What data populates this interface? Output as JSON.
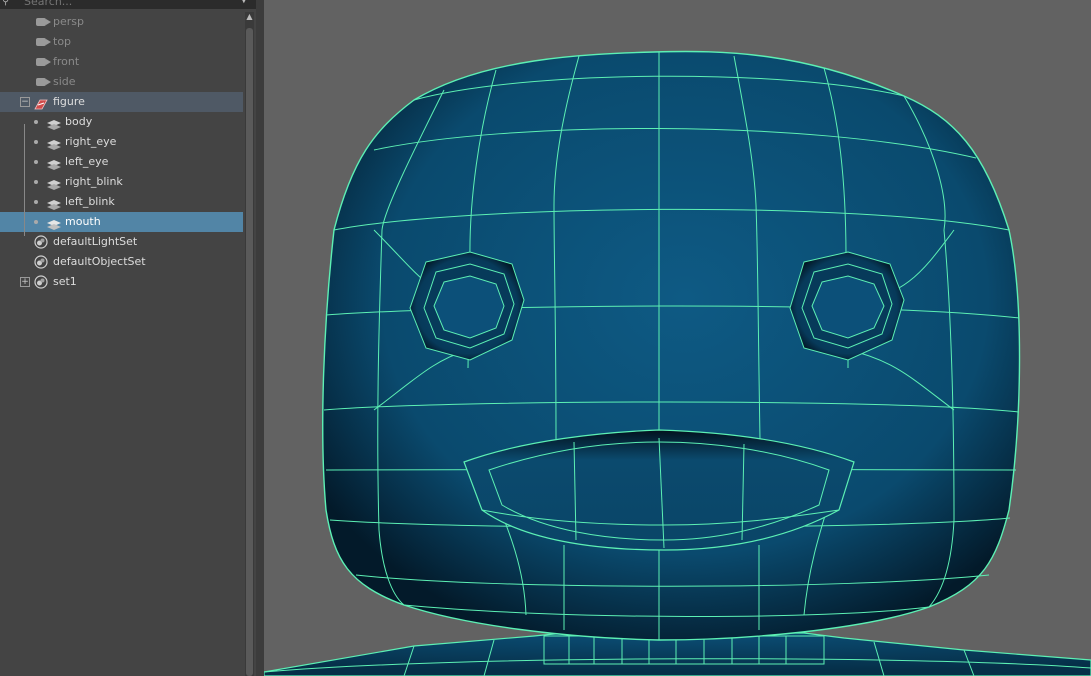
{
  "search": {
    "placeholder": "Search..."
  },
  "outliner": {
    "items": [
      {
        "label": "persp",
        "type": "camera"
      },
      {
        "label": "top",
        "type": "camera"
      },
      {
        "label": "front",
        "type": "camera"
      },
      {
        "label": "side",
        "type": "camera"
      },
      {
        "label": "figure",
        "type": "group"
      },
      {
        "label": "body",
        "type": "mesh"
      },
      {
        "label": "right_eye",
        "type": "mesh"
      },
      {
        "label": "left_eye",
        "type": "mesh"
      },
      {
        "label": "right_blink",
        "type": "mesh"
      },
      {
        "label": "left_blink",
        "type": "mesh"
      },
      {
        "label": "mouth",
        "type": "mesh",
        "selected": true
      },
      {
        "label": "defaultLightSet",
        "type": "set"
      },
      {
        "label": "defaultObjectSet",
        "type": "set"
      },
      {
        "label": "set1",
        "type": "set"
      }
    ]
  },
  "colors": {
    "mesh": "#0b4a6e",
    "wire": "#5cf0b4",
    "selection": "#5285a6",
    "viewport": "#626262"
  }
}
